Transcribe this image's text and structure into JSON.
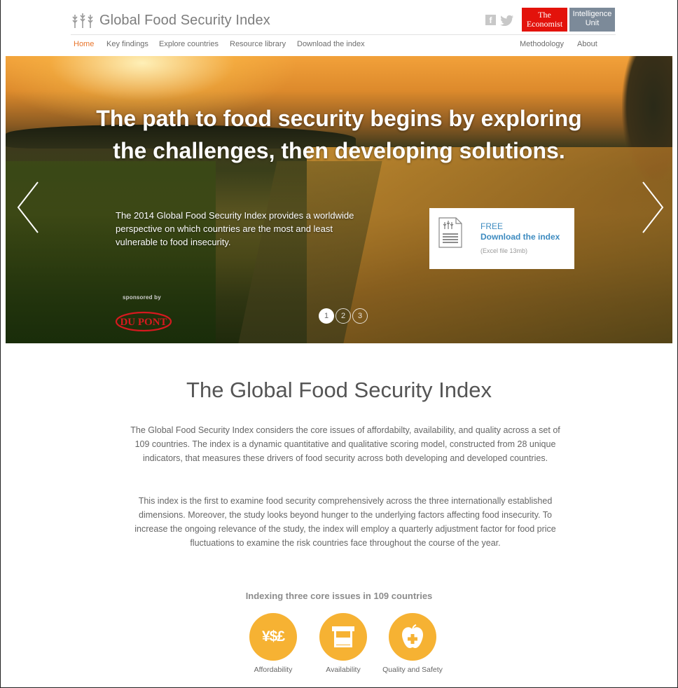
{
  "header": {
    "title": "Global Food Security Index",
    "social_facebook": "f",
    "economist_line1": "The",
    "economist_line2": "Economist",
    "eiu_line1": "Intelligence",
    "eiu_line2": "Unit"
  },
  "nav": {
    "items": [
      "Home",
      "Key findings",
      "Explore countries",
      "Resource library",
      "Download the index"
    ],
    "right_items": [
      "Methodology",
      "About"
    ],
    "active": "Home"
  },
  "hero": {
    "heading_line1": "The path to food security begins by exploring",
    "heading_line2": "the challenges, then developing solutions.",
    "description": "The 2014 Global Food Security Index provides a worldwide perspective on which countries are the most and least vulnerable to food insecurity.",
    "sponsored_by": "sponsored by",
    "sponsor": "DU PONT",
    "download": {
      "free": "FREE",
      "link": "Download the index",
      "meta": "(Excel file 13mb)"
    },
    "slides": [
      "1",
      "2",
      "3"
    ],
    "active_slide": 1
  },
  "main": {
    "title": "The Global Food Security Index",
    "paragraph1": "The Global Food Security Index considers the core issues of affordabilty, availability, and quality across a set of 109 countries. The index is a dynamic quantitative and qualitative scoring model, constructed from 28 unique indicators, that measures these drivers of food security across both developing and developed countries.",
    "paragraph2": "This index is the first to examine food security comprehensively across the three internationally established dimensions. Moreover, the study looks beyond hunger to the underlying factors affecting food insecurity. To increase the ongoing relevance of the study, the index will employ a quarterly adjustment factor for food price fluctuations to examine the risk countries face throughout the course of the year.",
    "issues_title": "Indexing three core issues in 109 countries",
    "issues": [
      {
        "label": "Affordability",
        "icon": "currency-icon",
        "symbol": "¥$£"
      },
      {
        "label": "Availability",
        "icon": "market-stall-icon"
      },
      {
        "label": "Quality and Safety",
        "icon": "apple-plus-icon"
      }
    ]
  },
  "colors": {
    "accent": "#e8742a",
    "issue_circle": "#f6b233",
    "link": "#3d8bc0",
    "economist_red": "#e3120b",
    "eiu_gray": "#7c8a99"
  }
}
